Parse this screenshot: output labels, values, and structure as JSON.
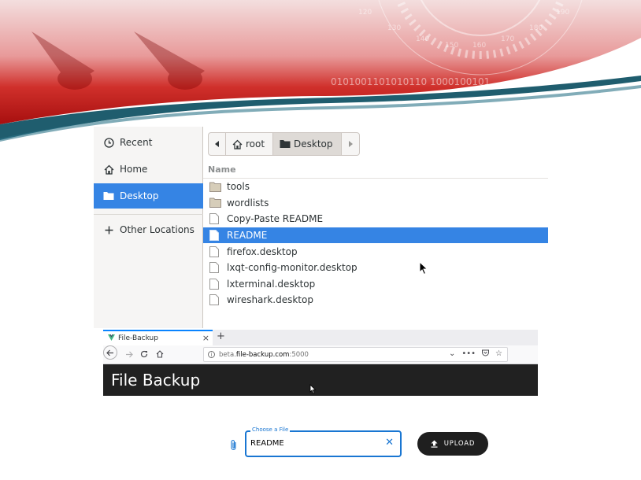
{
  "banner": {
    "numbers": [
      "120",
      "130",
      "140",
      "150",
      "160",
      "170",
      "180",
      "190"
    ],
    "binary_text": "0101001101010110 1000100101",
    "colors": {
      "red": "#cc1a1a",
      "dark_red": "#9b0b0b",
      "teal": "#1f5d6e"
    }
  },
  "places": [
    {
      "label": "Recent",
      "icon": "clock-icon"
    },
    {
      "label": "Home",
      "icon": "home-icon"
    },
    {
      "label": "Desktop",
      "icon": "folder-icon",
      "selected": true
    },
    {
      "label": "Other Locations",
      "icon": "plus-icon"
    }
  ],
  "pathbar": {
    "root": "root",
    "current": "Desktop"
  },
  "file_list": {
    "column_header": "Name",
    "rows": [
      {
        "name": "tools",
        "icon": "folder-icon"
      },
      {
        "name": "wordlists",
        "icon": "folder-icon"
      },
      {
        "name": "Copy-Paste README",
        "icon": "file-icon"
      },
      {
        "name": "README",
        "icon": "file-icon",
        "selected": true
      },
      {
        "name": "firefox.desktop",
        "icon": "file-icon"
      },
      {
        "name": "lxqt-config-monitor.desktop",
        "icon": "file-icon"
      },
      {
        "name": "lxterminal.desktop",
        "icon": "file-icon"
      },
      {
        "name": "wireshark.desktop",
        "icon": "file-icon"
      }
    ]
  },
  "browser": {
    "tab_title": "File-Backup",
    "tab_close": "×",
    "new_tab": "+",
    "url": {
      "prefix": "beta.",
      "host": "file-backup.com",
      "port": ":5000"
    },
    "app_title": "File Backup",
    "file_input": {
      "label": "Choose a File",
      "value": "README",
      "clear": "✕"
    },
    "upload_label": "UPLOAD"
  },
  "colors": {
    "selection": "#3584e4",
    "appbar": "#212121",
    "accent_blue": "#1976d2"
  }
}
